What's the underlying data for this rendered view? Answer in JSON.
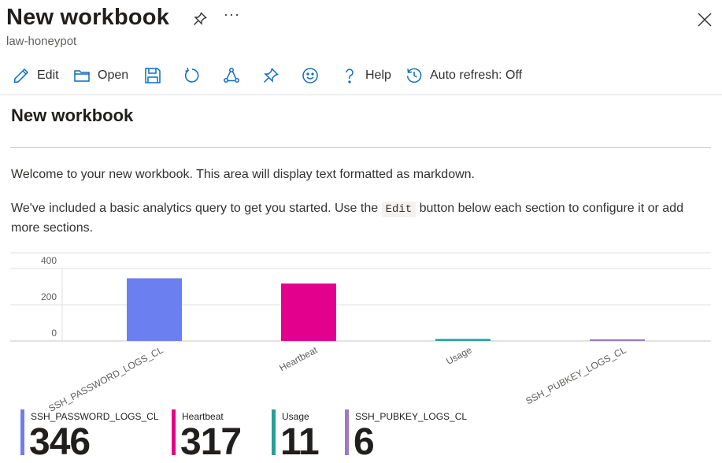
{
  "header": {
    "title": "New workbook",
    "subtitle": "law-honeypot",
    "more_label": "···"
  },
  "toolbar": {
    "edit_label": "Edit",
    "open_label": "Open",
    "help_label": "Help",
    "auto_refresh_label": "Auto refresh: Off"
  },
  "content": {
    "section_title": "New workbook",
    "paragraph1": "Welcome to your new workbook. This area will display text formatted as markdown.",
    "paragraph2_before": "We've included a basic analytics query to get you started. Use the ",
    "paragraph2_code": "Edit",
    "paragraph2_after": " button below each section to configure it or add more sections."
  },
  "chart_data": {
    "type": "bar",
    "categories": [
      "SSH_PASSWORD_LOGS_CL",
      "Heartbeat",
      "Usage",
      "SSH_PUBKEY_LOGS_CL"
    ],
    "values": [
      346,
      317,
      11,
      6
    ],
    "colors": [
      "#6b7ff0",
      "#e3008c",
      "#2a9d9d",
      "#9a79c6"
    ],
    "yticks": [
      0,
      200,
      400
    ],
    "ylim": [
      0,
      440
    ],
    "grid": true,
    "title": "",
    "xlabel": "",
    "ylabel": ""
  },
  "tiles": [
    {
      "name": "SSH_PASSWORD_LOGS_CL",
      "value": "346",
      "color": "#6b7ff0"
    },
    {
      "name": "Heartbeat",
      "value": "317",
      "color": "#e3008c"
    },
    {
      "name": "Usage",
      "value": "11",
      "color": "#2a9d9d"
    },
    {
      "name": "SSH_PUBKEY_LOGS_CL",
      "value": "6",
      "color": "#9a79c6"
    }
  ]
}
